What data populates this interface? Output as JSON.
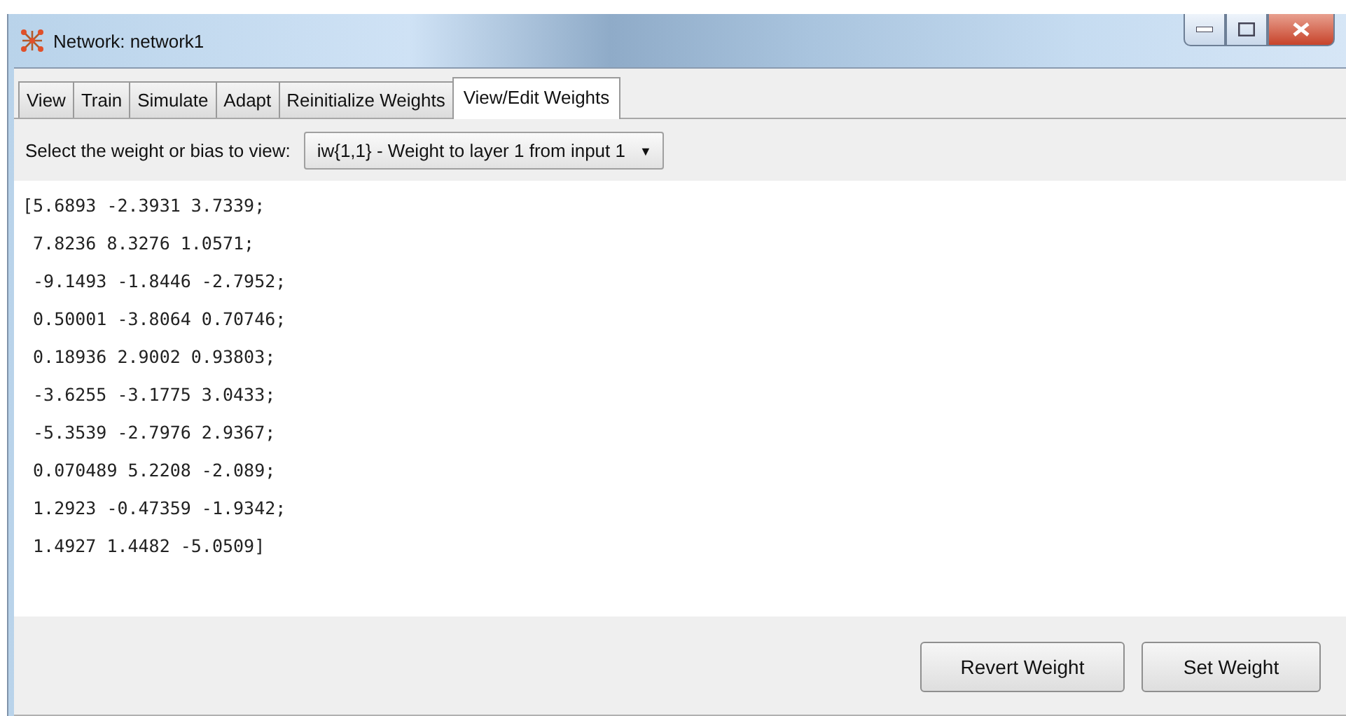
{
  "window": {
    "title": "Network: network1"
  },
  "tabs": [
    {
      "label": "View",
      "selected": false
    },
    {
      "label": "Train",
      "selected": false
    },
    {
      "label": "Simulate",
      "selected": false
    },
    {
      "label": "Adapt",
      "selected": false
    },
    {
      "label": "Reinitialize Weights",
      "selected": false
    },
    {
      "label": "View/Edit Weights",
      "selected": true
    }
  ],
  "selector": {
    "label": "Select the weight or bias to view:",
    "value": "iw{1,1} - Weight to layer 1 from input 1",
    "arrow": "▼"
  },
  "weights_text": [
    "[5.6893 -2.3931 3.7339;",
    " 7.8236 8.3276 1.0571;",
    " -9.1493 -1.8446 -2.7952;",
    " 0.50001 -3.8064 0.70746;",
    " 0.18936 2.9002 0.93803;",
    " -3.6255 -3.1775 3.0433;",
    " -5.3539 -2.7976 2.9367;",
    " 0.070489 5.2208 -2.089;",
    " 1.2923 -0.47359 -1.9342;",
    " 1.4927 1.4482 -5.0509]"
  ],
  "buttons": [
    "Revert Weight",
    "Set Weight"
  ]
}
